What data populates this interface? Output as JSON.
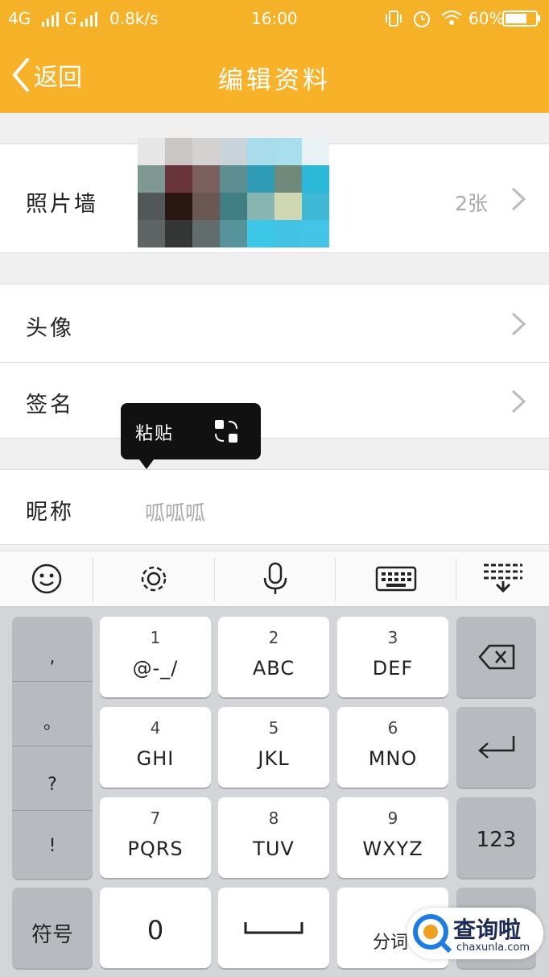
{
  "status_bar": {
    "network": "4G",
    "network2": "G",
    "speed": "0.8k/s",
    "time": "16:00",
    "battery": "60%"
  },
  "nav": {
    "back_label": "返回",
    "title": "编辑资料"
  },
  "rows": {
    "photo_wall": {
      "label": "照片墙",
      "count": "2张"
    },
    "avatar": {
      "label": "头像"
    },
    "signature": {
      "label": "签名"
    },
    "nickname": {
      "label": "昵称",
      "value": "呱呱呱"
    }
  },
  "popup": {
    "paste_label": "粘贴"
  },
  "keyboard": {
    "toolbar_icons": [
      "smiley-icon",
      "gear-icon",
      "microphone-icon",
      "keyboard-icon",
      "hide-keyboard-icon"
    ],
    "punctuation": [
      ",",
      "。",
      "?",
      "!"
    ],
    "keys": [
      {
        "num": "1",
        "letters": "@-_/"
      },
      {
        "num": "2",
        "letters": "ABC"
      },
      {
        "num": "3",
        "letters": "DEF"
      },
      {
        "num": "4",
        "letters": "GHI"
      },
      {
        "num": "5",
        "letters": "JKL"
      },
      {
        "num": "6",
        "letters": "MNO"
      },
      {
        "num": "7",
        "letters": "PQRS"
      },
      {
        "num": "8",
        "letters": "TUV"
      },
      {
        "num": "9",
        "letters": "WXYZ"
      }
    ],
    "symbols_label": "符号",
    "zero_label": "0",
    "numbers_label": "123",
    "partial_key_label": "分词"
  },
  "watermark": {
    "text": "查询啦",
    "sub": "chaxunla.com"
  },
  "colors": {
    "accent": "#f8b22a",
    "keyboard_bg": "#d3d5d9"
  }
}
